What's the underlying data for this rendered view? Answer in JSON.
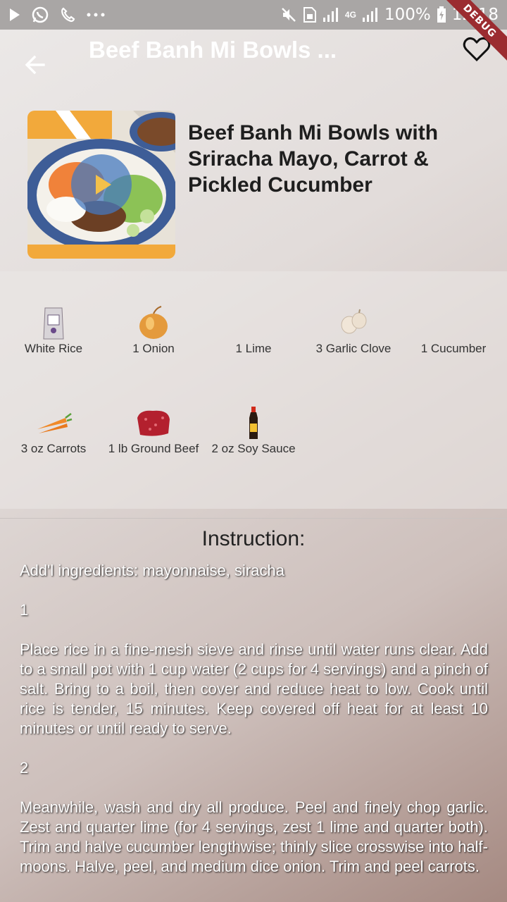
{
  "status_bar": {
    "battery": "100%",
    "time": "12:18",
    "network": "4G"
  },
  "debug_label": "DEBUG",
  "app_bar": {
    "title": "Beef Banh Mi Bowls ..."
  },
  "recipe": {
    "title": "Beef Banh Mi Bowls with Sriracha Mayo, Carrot & Pickled Cucumber"
  },
  "ingredients": [
    {
      "label": "White Rice",
      "icon": "rice-bag-icon"
    },
    {
      "label": "1 Onion",
      "icon": "onion-icon"
    },
    {
      "label": "1 Lime",
      "icon": "lime-icon"
    },
    {
      "label": "3 Garlic Clove",
      "icon": "garlic-icon"
    },
    {
      "label": "1 Cucumber",
      "icon": "cucumber-icon"
    },
    {
      "label": "3 oz  Carrots",
      "icon": "carrot-icon"
    },
    {
      "label": "1 lb Ground Beef",
      "icon": "ground-beef-icon"
    },
    {
      "label": "2 oz  Soy Sauce",
      "icon": "soy-sauce-icon"
    }
  ],
  "instructions": {
    "heading": "Instruction:",
    "additional": "Add'l ingredients: mayonnaise, siracha",
    "steps": [
      {
        "number": "1",
        "text": "Place rice in a fine-mesh sieve and rinse until water runs clear. Add to a small pot with 1 cup water (2 cups for 4 servings) and a pinch of salt. Bring to a boil, then cover and reduce heat to low. Cook until rice is tender, 15 minutes. Keep covered off heat for at least 10 minutes or until ready to serve."
      },
      {
        "number": "2",
        "text": "Meanwhile, wash and dry all produce. Peel and finely chop garlic. Zest and quarter lime (for 4 servings, zest 1 lime and quarter both). Trim and halve cucumber lengthwise; thinly slice crosswise into half-moons. Halve, peel, and medium dice onion. Trim and peel carrots."
      }
    ]
  }
}
